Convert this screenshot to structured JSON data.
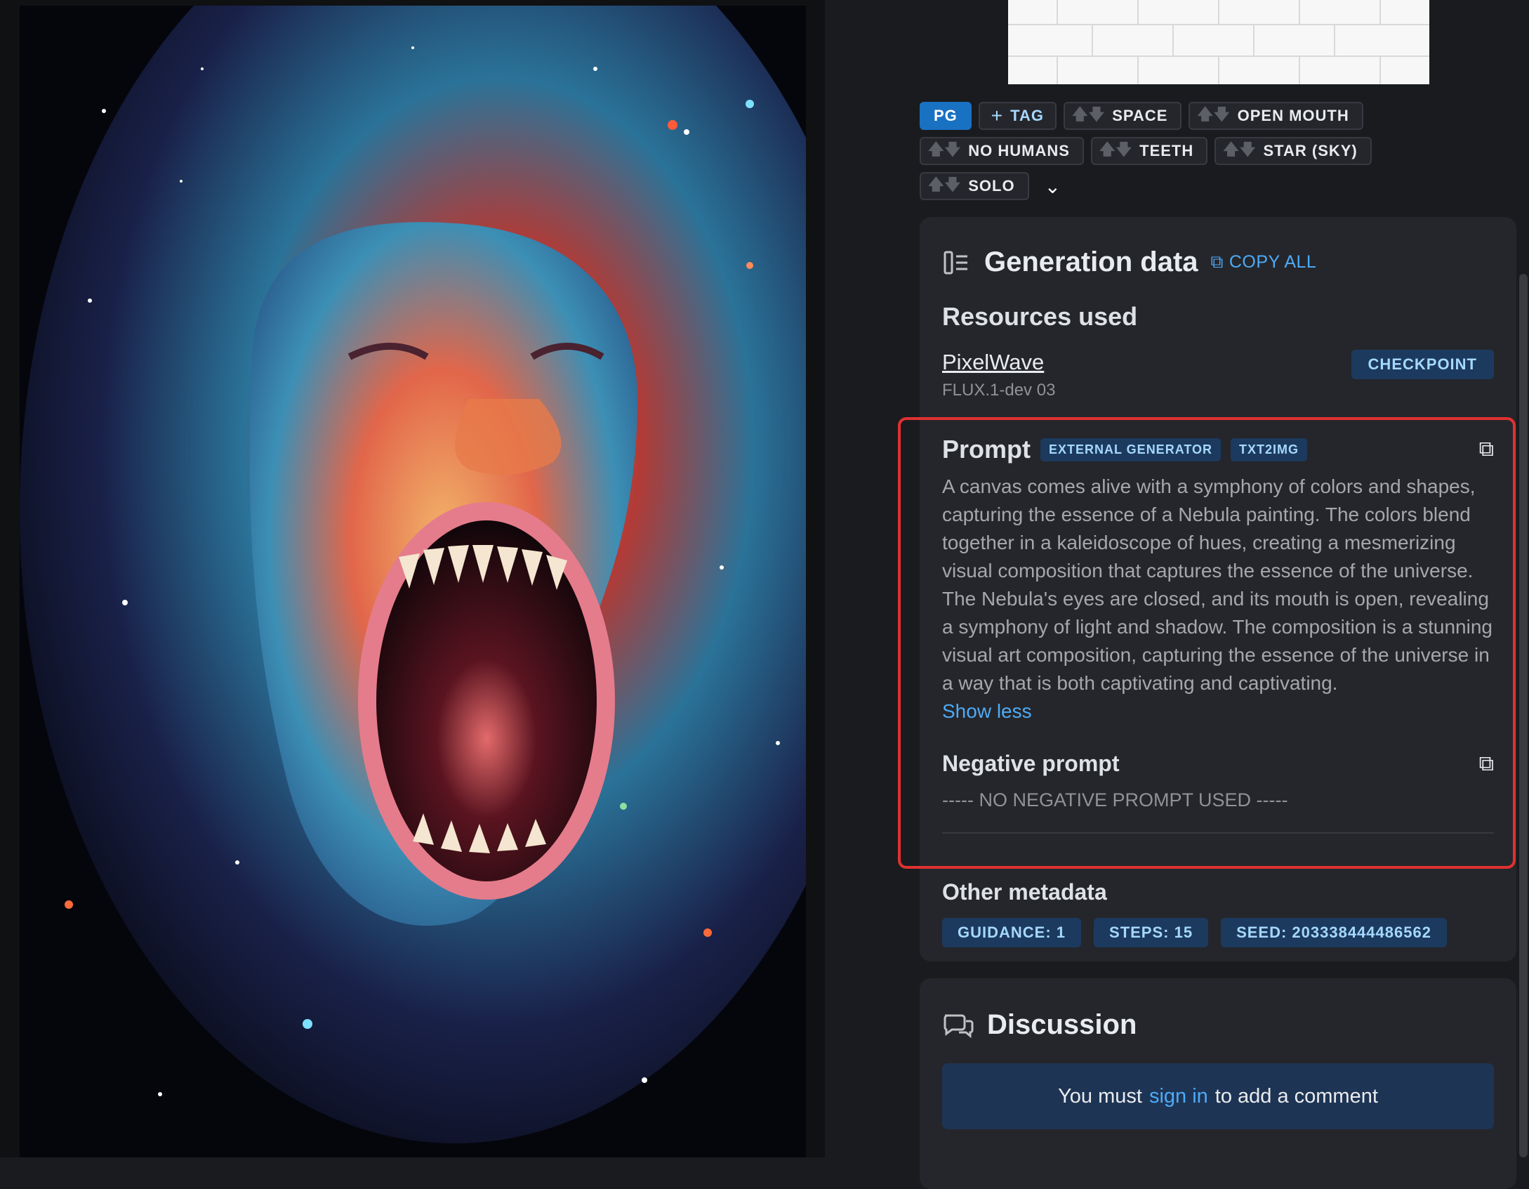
{
  "tags": {
    "rating": "PG",
    "add_label": "TAG",
    "items": [
      "SPACE",
      "OPEN MOUTH",
      "NO HUMANS",
      "TEETH",
      "STAR (SKY)",
      "SOLO"
    ]
  },
  "generation": {
    "title": "Generation data",
    "copy_all": "COPY ALL",
    "resources_title": "Resources used",
    "resource": {
      "name": "PixelWave",
      "version": "FLUX.1-dev 03",
      "type": "CHECKPOINT"
    },
    "prompt": {
      "title": "Prompt",
      "badges": [
        "EXTERNAL GENERATOR",
        "TXT2IMG"
      ],
      "text": "A canvas comes alive with a symphony of colors and shapes, capturing the essence of a Nebula painting. The colors blend together in a kaleidoscope of hues, creating a mesmerizing visual composition that captures the essence of the universe. The Nebula's eyes are closed, and its mouth is open, revealing a symphony of light and shadow. The composition is a stunning visual art composition, capturing the essence of the universe in a way that is both captivating and captivating.",
      "show_less": "Show less"
    },
    "negative": {
      "title": "Negative prompt",
      "text": "----- NO NEGATIVE PROMPT USED -----"
    },
    "other": {
      "title": "Other metadata",
      "guidance": "GUIDANCE: 1",
      "steps": "STEPS: 15",
      "seed": "SEED: 203338444486562"
    }
  },
  "discussion": {
    "title": "Discussion",
    "prefix": "You must",
    "link": "sign in",
    "suffix": "to add a comment"
  },
  "colors": {
    "accent": "#4dabf7",
    "highlight_border": "#e03131",
    "rating": "#1971c2"
  }
}
